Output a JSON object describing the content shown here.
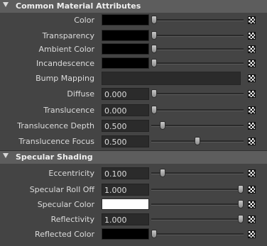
{
  "sections": [
    {
      "title": "Common Material Attributes",
      "rows": [
        {
          "label": "Color",
          "kind": "swatch",
          "color": "#000000",
          "slider": 0.0
        },
        {
          "label": "Transparency",
          "kind": "swatch",
          "color": "#000000",
          "slider": 0.0
        },
        {
          "label": "Ambient Color",
          "kind": "swatch",
          "color": "#000000",
          "slider": 0.0
        },
        {
          "label": "Incandescence",
          "kind": "swatch",
          "color": "#000000",
          "slider": 0.0
        },
        {
          "label": "Bump Mapping",
          "kind": "bump"
        },
        {
          "label": "Diffuse",
          "kind": "number",
          "value": "0.000",
          "slider": 0.0
        },
        {
          "label": "Translucence",
          "kind": "number",
          "value": "0.000",
          "slider": 0.0
        },
        {
          "label": "Translucence Depth",
          "kind": "number",
          "value": "0.500",
          "slider": 0.1
        },
        {
          "label": "Translucence Focus",
          "kind": "number",
          "value": "0.500",
          "slider": 0.5
        }
      ]
    },
    {
      "title": "Specular Shading",
      "rows": [
        {
          "label": "Eccentricity",
          "kind": "number",
          "value": "0.100",
          "slider": 0.1
        },
        {
          "label": "Specular Roll Off",
          "kind": "number",
          "value": "1.000",
          "slider": 1.0
        },
        {
          "label": "Specular Color",
          "kind": "swatch",
          "color": "#ffffff",
          "slider": 1.0
        },
        {
          "label": "Reflectivity",
          "kind": "number",
          "value": "1.000",
          "slider": 1.0
        },
        {
          "label": "Reflected Color",
          "kind": "swatch",
          "color": "#000000",
          "slider": 0.0
        }
      ]
    }
  ]
}
